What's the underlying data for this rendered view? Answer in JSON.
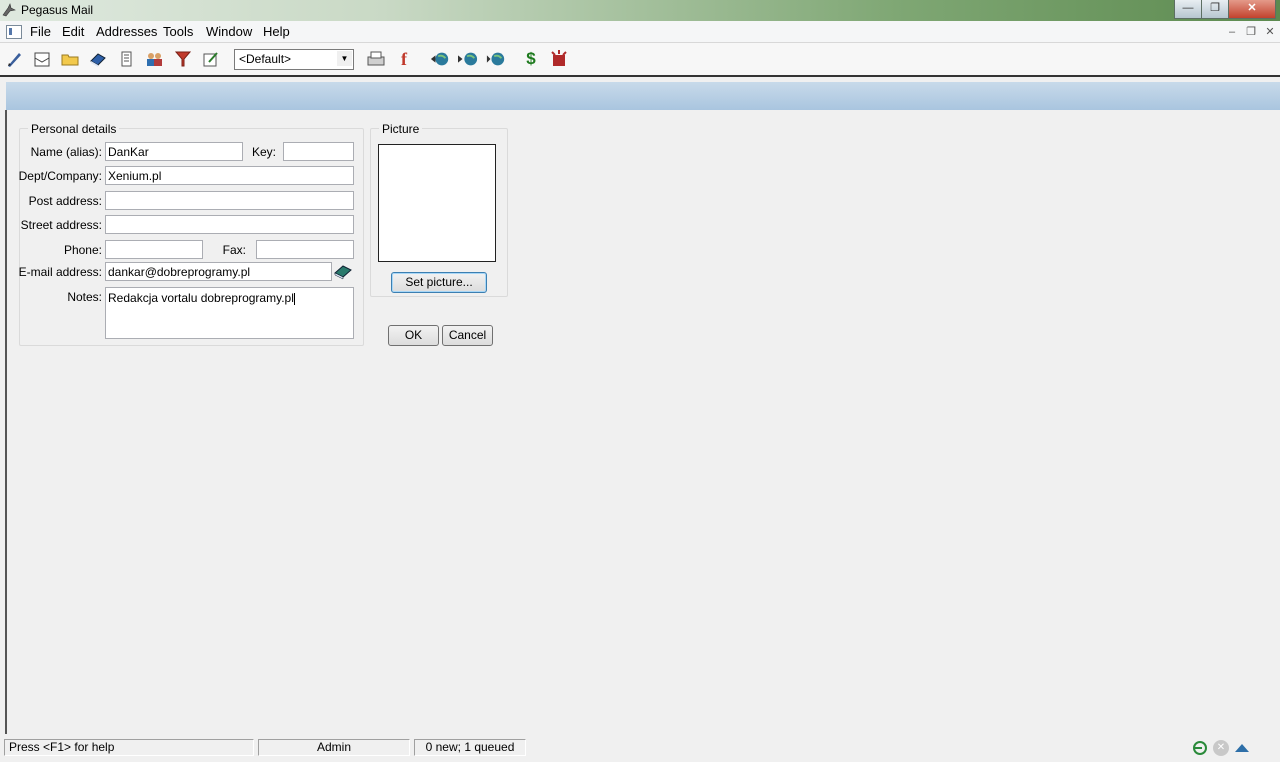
{
  "window": {
    "title": "Pegasus Mail"
  },
  "menu": {
    "items": [
      "File",
      "Edit",
      "Addresses",
      "Tools",
      "Window",
      "Help"
    ]
  },
  "toolbar": {
    "profile_selected": "<Default>",
    "icons": [
      "new-message-icon",
      "read-mail-icon",
      "folder-icon",
      "addressbook-icon",
      "notepad-icon",
      "users-icon",
      "filter-icon",
      "edit-note-icon",
      "print-icon",
      "f-icon",
      "check-mail-icon",
      "send-mail-icon",
      "check-send-icon",
      "dollar-icon",
      "alarm-icon"
    ]
  },
  "personal": {
    "legend": "Personal details",
    "name_label": "Name (alias):",
    "name_value": "DanKar",
    "key_label": "Key:",
    "key_value": "",
    "dept_label": "Dept/Company:",
    "dept_value": "Xenium.pl",
    "post_label": "Post address:",
    "post_value": "",
    "street_label": "Street address:",
    "street_value": "",
    "phone_label": "Phone:",
    "phone_value": "",
    "fax_label": "Fax:",
    "fax_value": "",
    "email_label": "E-mail address:",
    "email_value": "dankar@dobreprogramy.pl",
    "notes_label": "Notes:",
    "notes_value": "Redakcja vortalu dobreprogramy.pl"
  },
  "picture": {
    "legend": "Picture",
    "set_button": "Set picture..."
  },
  "actions": {
    "ok": "OK",
    "cancel": "Cancel"
  },
  "status": {
    "help": "Press <F1> for help",
    "user": "Admin",
    "queue": "0 new; 1 queued"
  },
  "colors": {
    "title_green": "#5c8a4f",
    "banner_blue": "#a9c5df"
  }
}
